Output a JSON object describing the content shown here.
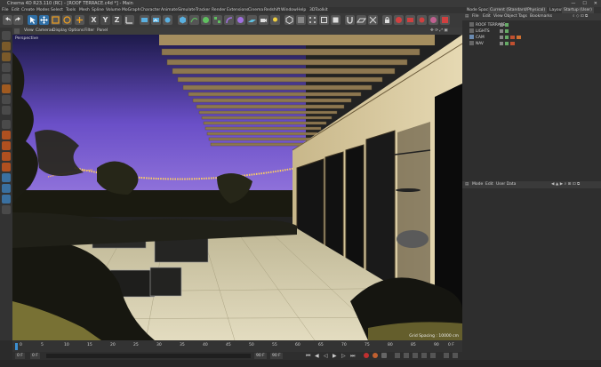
{
  "window": {
    "title": "Cinema 4D R23.110 (RC) - [ROOF TERRACE.c4d *] - Main",
    "controls": [
      "—",
      "☐",
      "✕"
    ]
  },
  "menubar": [
    "File",
    "Edit",
    "Create",
    "Modes",
    "Select",
    "Tools",
    "Mesh",
    "Spline",
    "Volume",
    "MoGraph",
    "Character",
    "Animate",
    "Simulate",
    "Tracker",
    "Render",
    "Extensions",
    "Cinema",
    "Redshift",
    "Window",
    "Help",
    "3DToolkit"
  ],
  "node_space": {
    "label": "Node Space:",
    "value": "Current (Standard/Physical)",
    "layout_label": "Layout:",
    "layout_value": "Startup (User)"
  },
  "toolbar": {
    "axis_labels": [
      "X",
      "Y",
      "Z"
    ]
  },
  "viewport": {
    "menu": [
      "View",
      "Cameras",
      "Display",
      "Options",
      "Filter",
      "Panel"
    ],
    "camera_label": "Perspective",
    "grid_spacing": "Grid Spacing : 10000 cm"
  },
  "object_manager": {
    "menu": [
      "File",
      "Edit",
      "View",
      "Object",
      "Tags",
      "Bookmarks"
    ],
    "objects": [
      {
        "name": "ROOF TERRACE"
      },
      {
        "name": "LIGHTS"
      },
      {
        "name": "CAM"
      },
      {
        "name": "NAV"
      }
    ]
  },
  "attribute_manager": {
    "menu": [
      "Mode",
      "Edit",
      "User Data"
    ]
  },
  "timeline": {
    "ticks": [
      "0",
      "5",
      "10",
      "15",
      "20",
      "25",
      "30",
      "35",
      "40",
      "45",
      "50",
      "55",
      "60",
      "65",
      "70",
      "75",
      "80",
      "85",
      "90"
    ],
    "end_label": "0 F"
  },
  "bottombar": {
    "start_frame": "0 F",
    "current_frame": "0 F",
    "end_frame": "90 F",
    "end_frame2": "90 F"
  },
  "colors": {
    "sky_top": "#1d1a4a",
    "sky_mid": "#6a4fc7",
    "sky_horizon": "#9a7ce0",
    "wood": "#a58e5f",
    "floor": "#d6cfb0",
    "accent": "#f0a020"
  }
}
